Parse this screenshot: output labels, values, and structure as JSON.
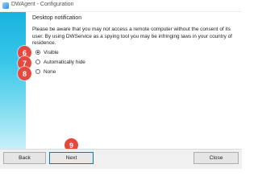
{
  "window": {
    "title": "DWAgent - Configuration"
  },
  "heading": "Desktop notification",
  "warning": "Please be aware that you may not access a remote computer without the consent of its user. By using DWService as a spying tool you may be infringing laws in your country of residence.",
  "options": [
    {
      "label": "Visible",
      "selected": true
    },
    {
      "label": "Automatically hide",
      "selected": false
    },
    {
      "label": "None",
      "selected": false
    }
  ],
  "badges": [
    "6",
    "7",
    "8",
    "9"
  ],
  "buttons": {
    "back": "Back",
    "next": "Next",
    "close": "Close"
  },
  "colors": {
    "badge": "#e4483f",
    "side_panel": "#36c6e8"
  }
}
